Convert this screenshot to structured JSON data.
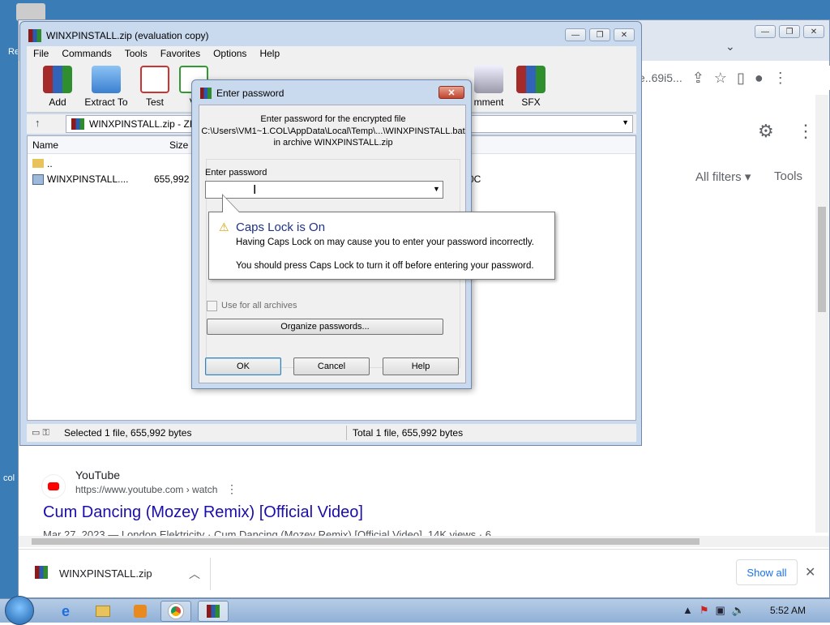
{
  "desktop": {
    "edge_label_top": "Re",
    "edge_label_bottom": "col"
  },
  "chrome": {
    "url_fragment": "e..69i5...",
    "all_filters": "All filters ▾",
    "tools": "Tools",
    "result": {
      "site_name": "YouTube",
      "site_url": "https://www.youtube.com › watch",
      "title": "Cum Dancing (Mozey Remix) [Official Video]",
      "snippet": "Mar 27, 2023 — London Elektricity · Cum Dancing (Mozey Remix) [Official Video]. 14K views · 6"
    },
    "download": {
      "file_name": "WINXPINSTALL.zip",
      "show_all": "Show all"
    }
  },
  "winrar": {
    "title": "WINXPINSTALL.zip (evaluation copy)",
    "menu": [
      "File",
      "Commands",
      "Tools",
      "Favorites",
      "Options",
      "Help"
    ],
    "toolbar": {
      "add": "Add",
      "extract": "Extract To",
      "test": "Test",
      "view": "Vi",
      "comment": "mment",
      "sfx": "SFX"
    },
    "path": "WINXPINSTALL.zip - ZIP",
    "columns": {
      "name": "Name",
      "size": "Size"
    },
    "rows": [
      {
        "name": "..",
        "size": "",
        "extra": ""
      },
      {
        "name": "WINXPINSTALL....",
        "size": "655,992",
        "extra": "0C"
      }
    ],
    "status_left": "Selected 1 file, 655,992 bytes",
    "status_right": "Total 1 file, 655,992 bytes"
  },
  "dialog": {
    "title": "Enter password",
    "message_line1": "Enter password for the encrypted file",
    "message_line2": "C:\\Users\\VM1~1.COL\\AppData\\Local\\Temp\\...\\WINXPINSTALL.bat",
    "message_line3": "in archive WINXPINSTALL.zip",
    "field_label": "Enter password",
    "field_value": "",
    "checkbox_label": "Use for all archives",
    "organize": "Organize passwords...",
    "ok": "OK",
    "cancel": "Cancel",
    "help": "Help"
  },
  "balloon": {
    "title": "Caps Lock is On",
    "line1": "Having Caps Lock on may cause you to enter your password incorrectly.",
    "line2": "You should press Caps Lock to turn it off before entering your password."
  },
  "taskbar": {
    "clock": "5:52 AM"
  },
  "colors": {
    "link": "#1a0dab",
    "balloon_title": "#1e3287",
    "accent_blue": "#1a73e8"
  }
}
